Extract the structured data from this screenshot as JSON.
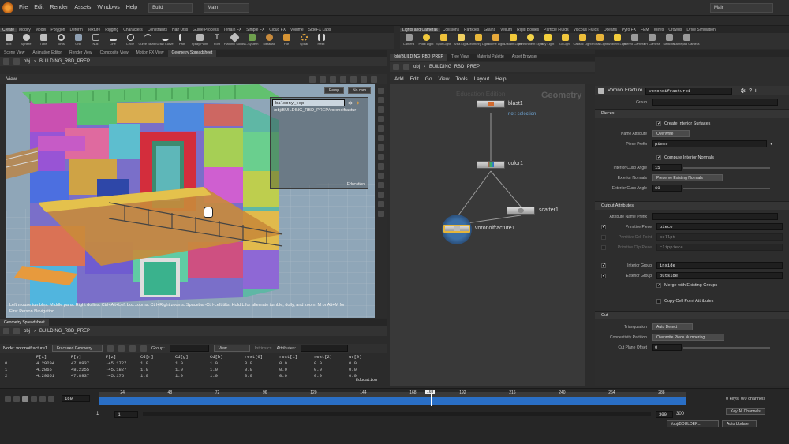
{
  "menubar": {
    "items": [
      "File",
      "Edit",
      "Render",
      "Assets",
      "Windows",
      "Help"
    ],
    "desktop": "Build",
    "main_left": "Main",
    "main_right": "Main"
  },
  "shelf_left": {
    "tabs": [
      "Create",
      "Modify",
      "Model",
      "Polygon",
      "Deform",
      "Texture",
      "Rigging",
      "Characters",
      "Constraints",
      "Hair Utils",
      "Guide Process",
      "Terrain FX",
      "Simple FX",
      "Cloud FX",
      "Volume",
      "SideFX Labs"
    ],
    "tools": [
      "Box",
      "Sphere",
      "Tube",
      "Torus",
      "Grid",
      "Null",
      "Line",
      "Circle",
      "Curve Bezier",
      "Draw Curve",
      "Path",
      "Spray Paint",
      "Font",
      "Platonic Solids",
      "L-System",
      "Metaball",
      "File",
      "Spiral",
      "Helix"
    ]
  },
  "shelf_right": {
    "tabs": [
      "Lights and Cameras",
      "Collisions",
      "Particles",
      "Grains",
      "Vellum",
      "Rigid Bodies",
      "Particle Fluids",
      "Viscous Fluids",
      "Oceans",
      "Pyro FX",
      "FEM",
      "Wires",
      "Crowds",
      "Drive Simulation"
    ],
    "tools": [
      "Camera",
      "Point Light",
      "Spot Light",
      "Area Light",
      "Geometry Light",
      "Volume Light",
      "Distant Light",
      "Environment Light",
      "Sky Light",
      "GI Light",
      "Caustic Light",
      "Portal Light",
      "Ambient Light",
      "Stereo Camera",
      "VR Camera",
      "Switcher",
      "Gamepad Camera"
    ]
  },
  "left_panel": {
    "tabs": [
      "Scene View",
      "Animation Editor",
      "Render View",
      "Composite View",
      "Motion FX View",
      "Geometry Spreadsheet"
    ],
    "path": [
      "obj",
      "BUILDING_RBD_PREP"
    ],
    "view_label": "View",
    "persp": "Persp",
    "cam": "No cam",
    "overlay_name": "balcony_top",
    "overlay_path": "/obj/BUILDING_RBD_PREP/voronoifractur",
    "education_tag": "Education",
    "help_text": "Left mouse tumbles. Middle pans. Right dollies. Ctrl+Alt+Left box zooms. Ctrl+Right zooms. Spacebar-Ctrl-Left tilts. Hold L for alternate tumble, dolly, and zoom.    M or Alt+M for First Person Navigation."
  },
  "spreadsheet": {
    "tab": "Geometry Spreadsheet",
    "path": [
      "obj",
      "BUILDING_RBD_PREP"
    ],
    "node": "Node: voronoifracture1",
    "mode": "Fractured Geometry",
    "group_label": "Group:",
    "view_label": "View",
    "intrinsics": "Intrinsics",
    "attributes_label": "Attributes:",
    "columns": [
      "",
      "P[x]",
      "P[y]",
      "P[z]",
      "Cd[r]",
      "Cd[g]",
      "Cd[b]",
      "rest[0]",
      "rest[1]",
      "rest[2]",
      "uv[0]"
    ],
    "rows": [
      [
        "0",
        "4.29294",
        "47.8937",
        "-45.1727",
        "1.0",
        "1.0",
        "1.0",
        "0.0",
        "0.0",
        "0.0",
        "0.0"
      ],
      [
        "1",
        "4.2865",
        "48.2255",
        "-45.1827",
        "1.0",
        "1.0",
        "1.0",
        "0.0",
        "0.0",
        "0.0",
        "0.0"
      ],
      [
        "2",
        "4.29651",
        "47.8937",
        "-45.175",
        "1.0",
        "1.0",
        "1.0",
        "0.0",
        "0.0",
        "0.0",
        "0.0"
      ]
    ],
    "education_tag": "Education"
  },
  "network": {
    "tabs": [
      "/obj/BUILDING_RBD_PREP",
      "Tree View",
      "Material Palette",
      "Asset Browser"
    ],
    "path": [
      "obj",
      "BUILDING_RBD_PREP"
    ],
    "menu": [
      "Add",
      "Edit",
      "Go",
      "View",
      "Tools",
      "Layout",
      "Help"
    ],
    "watermark": "Education Edition",
    "context": "Geometry",
    "nodes": {
      "blast": "blast1",
      "blast_sub": "not: selection",
      "color": "color1",
      "scatter": "scatter1",
      "voronoi": "voronoifracture1"
    }
  },
  "params": {
    "type": "Voronoi Fracture",
    "name": "voronoifracture1",
    "group_label": "Group",
    "pieces_section": "Pieces",
    "create_interior": "Create Interior Surfaces",
    "name_attr_label": "Name Attribute",
    "name_attr_value": "Overwrite",
    "piece_prefix_label": "Piece Prefix",
    "piece_prefix_value": "piece",
    "compute_normals": "Compute Interior Normals",
    "cusp_int_label": "Interior Cusp Angle",
    "cusp_int_value": "15",
    "ext_normals_label": "Exterior Normals",
    "ext_normals_value": "Preserve Existing Normals",
    "cusp_ext_label": "Exterior Cusp Angle",
    "cusp_ext_value": "60",
    "output_section": "Output Attributes",
    "attr_prefix_label": "Attribute Name Prefix",
    "prim_piece_label": "Primitive Piece",
    "prim_piece_value": "piece",
    "prim_cell_label": "Primitive Cell Point",
    "prim_cell_value": "cellpt",
    "prim_clip_label": "Primitive Clip Piece",
    "prim_clip_value": "clippiece",
    "interior_group_label": "Interior Group",
    "interior_group_value": "inside",
    "exterior_group_label": "Exterior Group",
    "exterior_group_value": "outside",
    "merge_groups": "Merge with Existing Groups",
    "copy_cell": "Copy Cell Point Attributes",
    "cut_section": "Cut",
    "triangulation_label": "Triangulation",
    "triangulation_value": "Auto Detect",
    "connectivity_label": "Connectivity Partition",
    "connectivity_value": "Overwrite Piece Numbering",
    "cut_offset_label": "Cut Plane Offset",
    "cut_offset_value": "0"
  },
  "timeline": {
    "current_frame": "169",
    "ticks": [
      "24",
      "48",
      "72",
      "96",
      "120",
      "144",
      "168",
      "192",
      "216",
      "240",
      "264",
      "288"
    ],
    "playhead": "169",
    "start": "1",
    "start2": "1",
    "end": "300",
    "end2": "300",
    "keys": "0 keys, 0/0 channels",
    "key_all": "Key All Channels",
    "status_path": "/obj/BOULDER...",
    "auto_update": "Auto Update",
    "playhead_fraction": 0.565
  },
  "colors": {
    "accent": "#e8a43a",
    "timeline_blue": "#2a6fc6",
    "node_selected": "#e5b53a"
  }
}
